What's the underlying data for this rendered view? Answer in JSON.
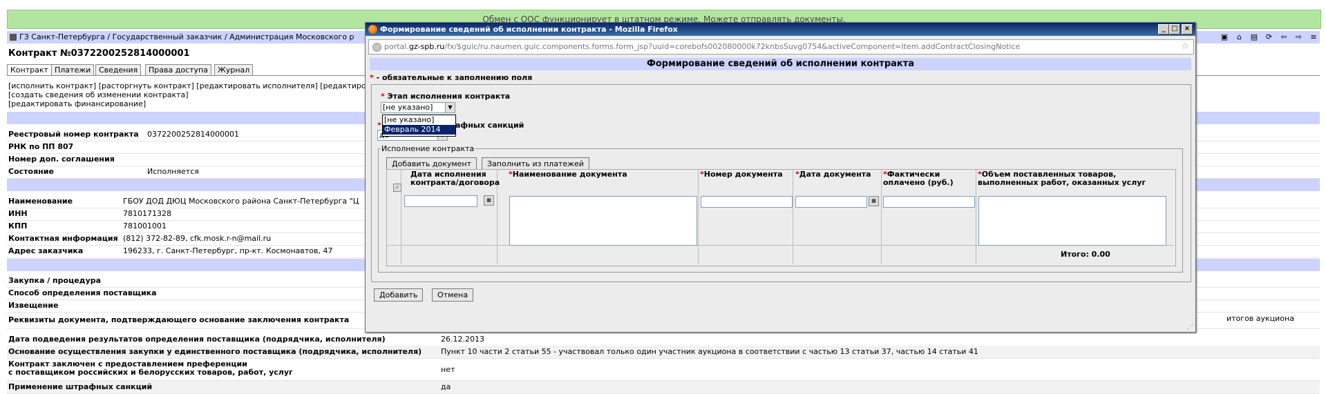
{
  "banner": {
    "text": "Обмен с ООС функционирует в штатном режиме. Можете отправлять документы."
  },
  "breadcrumb": {
    "text": "ГЗ Санкт-Петербурга / Государственный заказчик / Администрация Московского р"
  },
  "page": {
    "title": "Контракт №0372200252814000001",
    "tabs": [
      "Контракт",
      "Платежи",
      "Сведения",
      "Права доступа",
      "Журнал"
    ],
    "actions_line1": "[исполнить контракт] [расторгнуть контракт] [редактировать исполнителя] [редактиро",
    "actions_line2": "[создать сведения об изменении контракта]",
    "actions_line3": "[редактировать финансирование]",
    "rows_a": [
      {
        "label": "Реестровый номер контракта",
        "value": "0372200252814000001"
      },
      {
        "label": "РНК по ПП 807",
        "value": ""
      },
      {
        "label": "Номер доп. соглашения",
        "value": ""
      },
      {
        "label": "Состояние",
        "value": "Исполняется"
      }
    ],
    "rows_b": [
      {
        "label": "Наименование",
        "value": "ГБОУ ДОД ДЮЦ Московского района Санкт-Петербурга \"Ц"
      },
      {
        "label": "ИНН",
        "value": "7810171328"
      },
      {
        "label": "КПП",
        "value": "781001001"
      },
      {
        "label": "Контактная информация",
        "value": "(812) 372-82-89, cfk.mosk.r-n@mail.ru"
      },
      {
        "label": "Адрес заказчика",
        "value": "196233, г. Санкт-Петербург, пр-кт. Космонавтов, 47"
      }
    ],
    "rows_c": [
      {
        "label": "Закупка / процедура",
        "value": ""
      },
      {
        "label": "Способ определения поставщика",
        "value": ""
      },
      {
        "label": "Извещение",
        "value": ""
      },
      {
        "label": "Реквизиты документа, подтверждающего основание заключения контракта",
        "value": "итогов аукциона"
      },
      {
        "label": "Дата подведения результатов определения поставщика (подрядчика, исполнителя)",
        "value": "26.12.2013"
      },
      {
        "label": "Основание осуществления закупки у единственного поставщика (подрядчика, исполнителя)",
        "value": "Пункт 10 части 2 статьи 55 - участвовал только один участник аукциона в соответствии с частью 13 статьи 37, частью 14 статьи 41"
      },
      {
        "label_line1": "Контракт заключен с предоставлением преференции",
        "label_line2": "с поставщиком российских и белорусских товаров, работ, услуг",
        "value": "нет"
      },
      {
        "label": "Применение штрафных санкций",
        "value": "да"
      }
    ]
  },
  "popup": {
    "title": "Формирование сведений об исполнении контракта - Mozilla Firefox",
    "url_prefix": "portal.",
    "url_domain": "gz-spb.ru",
    "url_rest": "/fx/$guic/ru.naumen.guic.components.forms.form_jsp?uuid=corebofs002080000k72knbsSuvg0754&activeComponent=Item.addContractClosingNotice",
    "header": "Формирование сведений об исполнении контракта",
    "required_note": " - обязательные к заполнению поля",
    "stage_label": "Этап исполнения контракта",
    "stage_value": "[не указано]",
    "stage_options": [
      "[не указано]",
      "Февраль 2014"
    ],
    "penalty_label_tail": "афных санкций",
    "penalty_value": "да",
    "fieldset_legend": "Исполнение контракта",
    "add_doc_button": "Добавить документ",
    "fill_payments_button": "Заполнить из платежей",
    "columns": {
      "date_exec_1": "Дата исполнения",
      "date_exec_2": "контракта/договора",
      "doc_name": "Наименование документа",
      "doc_number": "Номер документа",
      "doc_date": "Дата документа",
      "paid_1": "Фактически",
      "paid_2": "оплачено (руб.)",
      "volume_1": "Объем поставленных товаров,",
      "volume_2": "выполненных работ, оказанных услуг"
    },
    "total": "Итого: 0.00",
    "add_button": "Добавить",
    "cancel_button": "Отмена"
  }
}
